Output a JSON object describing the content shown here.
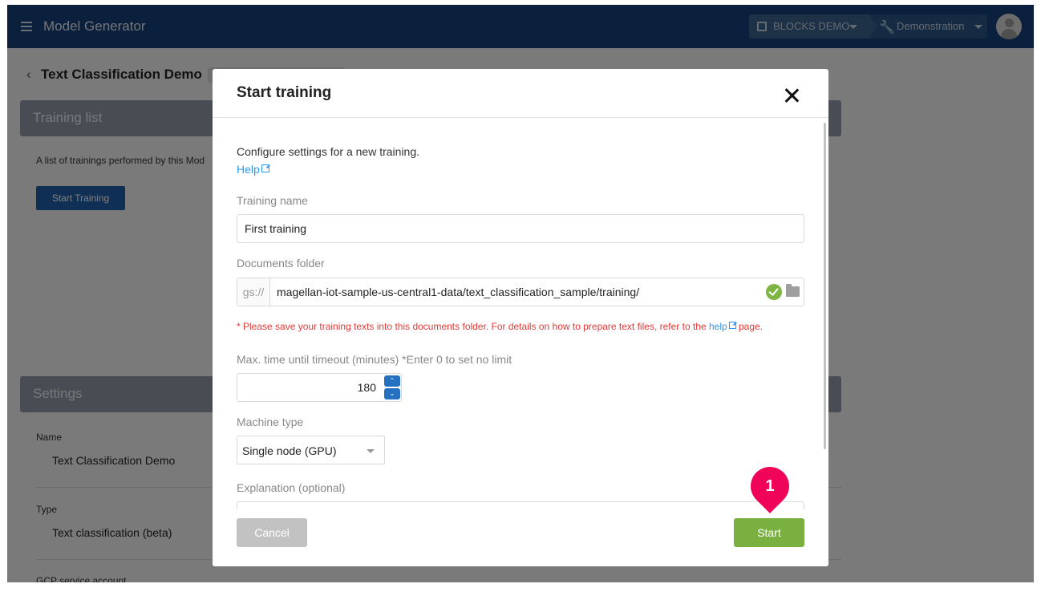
{
  "header": {
    "app_title": "Model Generator",
    "organization": "BLOCKS DEMO",
    "project": "Demonstration",
    "brand_color": "#17417a"
  },
  "page": {
    "title": "Text Classification Demo",
    "training_list": {
      "heading": "Training list",
      "description": "A list of trainings performed by this Mod",
      "start_button": "Start Training"
    },
    "settings": {
      "heading": "Settings",
      "fields": [
        {
          "label": "Name",
          "value": "Text Classification Demo"
        },
        {
          "label": "Type",
          "value": "Text classification (beta)"
        },
        {
          "label": "GCP service account",
          "value": ""
        }
      ]
    }
  },
  "modal": {
    "title": "Start training",
    "intro": "Configure settings for a new training.",
    "help_link": "Help",
    "training_name": {
      "label": "Training name",
      "value": "First training"
    },
    "documents_folder": {
      "label": "Documents folder",
      "prefix": "gs://",
      "value": "magellan-iot-sample-us-central1-data/text_classification_sample/training/",
      "status": "valid"
    },
    "note": {
      "before": "* Please save your training texts into this documents folder. For details on how to prepare text files, refer to the ",
      "link": "help",
      "after": " page."
    },
    "timeout": {
      "label": "Max. time until timeout (minutes) *Enter 0 to set no limit",
      "value": "180"
    },
    "machine_type": {
      "label": "Machine type",
      "value": "Single node (GPU)"
    },
    "explanation": {
      "label": "Explanation (optional)",
      "value": ""
    },
    "cancel_button": "Cancel",
    "start_button": "Start",
    "start_color": "#7ab03f"
  },
  "callout": {
    "number": "1",
    "color": "#f0045a"
  }
}
